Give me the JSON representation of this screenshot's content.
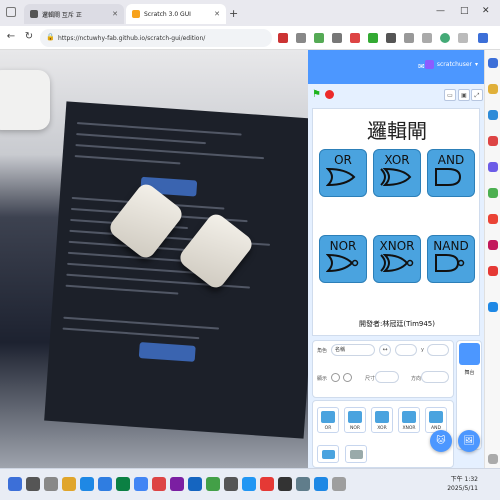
{
  "browser": {
    "tabs": [
      {
        "title": "邏輯閘 互斥 正",
        "favicon_color": "#555555",
        "active": false
      },
      {
        "title": "Scratch 3.0 GUI",
        "favicon_color": "#f7a21c",
        "active": true
      }
    ],
    "new_tab": "+",
    "window_controls": {
      "minimize": "—",
      "maximize": "□",
      "close": "✕"
    },
    "url": "https://nctuwhy-fab.github.io/scratch-gui/edition/",
    "nav": {
      "back": "←",
      "refresh": "↻"
    }
  },
  "scratch": {
    "user": "scratchuser",
    "stage_title": "邏輯閘",
    "gates": [
      {
        "label": "OR",
        "shape": "or"
      },
      {
        "label": "XOR",
        "shape": "xor"
      },
      {
        "label": "AND",
        "shape": "and"
      },
      {
        "label": "NOR",
        "shape": "nor"
      },
      {
        "label": "XNOR",
        "shape": "xnor"
      },
      {
        "label": "NAND",
        "shape": "nand"
      }
    ],
    "credit": "開發者:林冠廷(Tim945)",
    "sprite_info": {
      "sprite_label": "角色",
      "sprite_name": "名稱",
      "show_label": "顯示",
      "size_label": "尺寸",
      "direction_label": "方向",
      "x_label": "x",
      "y_label": "y"
    },
    "stage_panel_label": "舞台",
    "sprites": [
      {
        "name": "OR"
      },
      {
        "name": "NOR"
      },
      {
        "name": "XOR"
      },
      {
        "name": "XNOR"
      },
      {
        "name": "AND"
      }
    ],
    "accent": "#4c97ff"
  },
  "taskbar": {
    "time": "下午 1:32",
    "date": "2025/5/11"
  }
}
